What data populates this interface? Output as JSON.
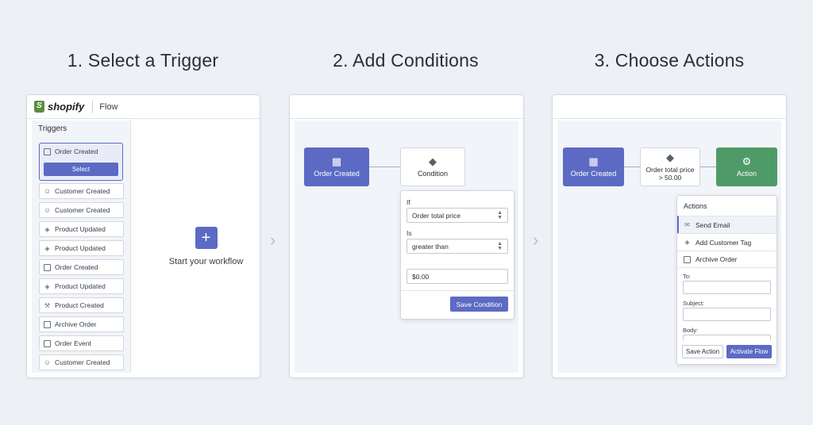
{
  "steps": [
    {
      "title": "1. Select a Trigger"
    },
    {
      "title": "2. Add Conditions"
    },
    {
      "title": "3. Choose Actions"
    }
  ],
  "panel1": {
    "brand": "shopify",
    "app_name": "Flow",
    "sidebar_title": "Triggers",
    "selected_trigger": {
      "label": "Order Created",
      "button": "Select",
      "icon": "calendar-icon"
    },
    "triggers": [
      {
        "label": "Customer Created",
        "icon": "user-icon"
      },
      {
        "label": "Customer Created",
        "icon": "user-icon"
      },
      {
        "label": "Product Updated",
        "icon": "tag-icon"
      },
      {
        "label": "Product Updated",
        "icon": "tag-icon"
      },
      {
        "label": "Order Created",
        "icon": "calendar-icon"
      },
      {
        "label": "Product Updated",
        "icon": "tag-icon"
      },
      {
        "label": "Product Created",
        "icon": "wrench-icon"
      },
      {
        "label": "Archive Order",
        "icon": "archive-icon"
      },
      {
        "label": "Order Event",
        "icon": "calendar-icon"
      },
      {
        "label": "Customer Created",
        "icon": "user-icon"
      }
    ],
    "start_label": "Start your workflow"
  },
  "panel2": {
    "trigger_node": "Order Created",
    "condition_node": "Condition",
    "if_label": "If",
    "if_value": "Order total price",
    "is_label": "Is",
    "is_value": "greater than",
    "amount_value": "$0.00",
    "save_button": "Save Condition"
  },
  "panel3": {
    "trigger_node": "Order Created",
    "condition_node_line1": "Order total price",
    "condition_node_line2": "> 50.00",
    "action_node": "Action",
    "actions_title": "Actions",
    "actions": [
      {
        "label": "Send Email",
        "icon": "mail-icon"
      },
      {
        "label": "Add Customer Tag",
        "icon": "tag-icon"
      },
      {
        "label": "Archive Order",
        "icon": "archive-icon"
      }
    ],
    "to_label": "To:",
    "subject_label": "Subject:",
    "body_label": "Body:",
    "save_button": "Save Action",
    "activate_button": "Activate Flow"
  },
  "colors": {
    "primary": "#5c6ac4",
    "success": "#4f9b68",
    "background": "#edf1f6"
  }
}
